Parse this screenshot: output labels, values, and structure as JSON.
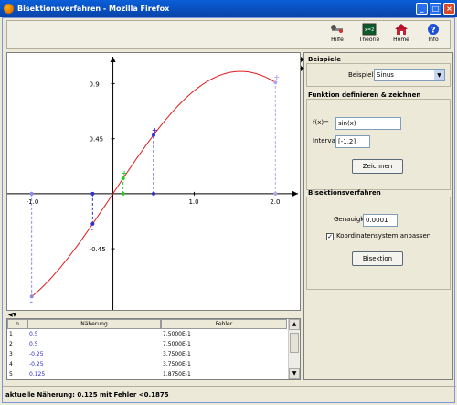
{
  "window": {
    "title": "Bisektionsverfahren - Mozilla Firefox"
  },
  "toolbar": {
    "items": [
      {
        "label": "Hilfe",
        "icon": "help-tools-icon"
      },
      {
        "label": "Theorie",
        "icon": "theory-screen-icon"
      },
      {
        "label": "Home",
        "icon": "home-icon"
      },
      {
        "label": "Info",
        "icon": "info-icon"
      }
    ]
  },
  "chart_data": {
    "type": "line",
    "xticks": [
      "-1.0",
      "1.0",
      "2.0"
    ],
    "yticks": [
      "0.9",
      "0.45",
      "-0.45"
    ],
    "xlim": [
      -1.3,
      2.3
    ],
    "ylim": [
      -0.95,
      1.15
    ],
    "function": "sin(x)",
    "curve_color": "#e21b1b",
    "interval_markers": [
      {
        "x": -1.0,
        "y": -0.841,
        "color": "#8a8af0",
        "sign": "-"
      },
      {
        "x": 2.0,
        "y": 0.909,
        "color": "#b0a8f0",
        "sign": "+"
      },
      {
        "x": -0.25,
        "y": -0.247,
        "color": "#3030d0",
        "sign": "-"
      },
      {
        "x": 0.5,
        "y": 0.479,
        "color": "#3030d0",
        "sign": "+"
      },
      {
        "x": 0.125,
        "y": 0.125,
        "color": "#22cc22",
        "sign": "+"
      }
    ]
  },
  "table": {
    "headers": [
      "n",
      "Näherung",
      "Fehler"
    ],
    "rows": [
      {
        "n": "1",
        "approx": "0.5",
        "err": "7.5000E-1"
      },
      {
        "n": "2",
        "approx": "0.5",
        "err": "7.5000E-1"
      },
      {
        "n": "3",
        "approx": "-0.25",
        "err": "3.7500E-1"
      },
      {
        "n": "4",
        "approx": "-0.25",
        "err": "3.7500E-1"
      },
      {
        "n": "5",
        "approx": "0.125",
        "err": "1.8750E-1"
      }
    ]
  },
  "panel": {
    "examples": {
      "title": "Beispiele",
      "label": "Beispiel",
      "selected": "Sinus"
    },
    "define": {
      "title": "Funktion definieren & zeichnen",
      "f_label": "f(x)=",
      "f_value": "sin(x)",
      "interval_label": "Intervall",
      "interval_value": "[-1,2]",
      "draw_button": "Zeichnen"
    },
    "bisection": {
      "title": "Bisektionsverfahren",
      "acc_label": "Genauigkeit",
      "acc_value": "0.0001",
      "check_label": "Koordinatensystem anpassen",
      "checked": "✓",
      "run_button": "Bisektion"
    }
  },
  "status": {
    "text": "aktuelle Näherung: 0.125 mit Fehler <0.1875"
  }
}
